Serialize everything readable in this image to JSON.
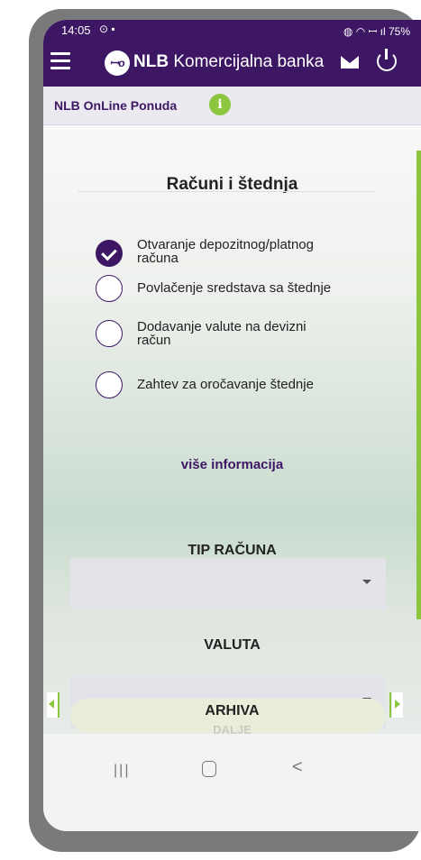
{
  "status_bar": {
    "time": "14:05",
    "left_icons": "⊙ ▪",
    "right_icons": "◍ ◠ ꟷ ıl",
    "battery": "75%"
  },
  "app_bar": {
    "brand_bold": "NLB",
    "brand_rest": " Komercijalna banka",
    "logo_text": "ꟷo"
  },
  "subheader": {
    "label": "NLB OnLine Ponuda",
    "info_glyph": "i"
  },
  "section": {
    "title": "Računi i štednja"
  },
  "options": [
    {
      "line1": "Otvaranje depozitnog/platnog",
      "line2": "računa",
      "checked": true
    },
    {
      "line1": "Povlačenje sredstava sa štednje",
      "line2": "",
      "checked": false
    },
    {
      "line1": "Dodavanje valute na devizni",
      "line2": "račun",
      "checked": false
    },
    {
      "line1": "Zahtev za oročavanje štednje",
      "line2": "",
      "checked": false
    }
  ],
  "more_info": "više informacija",
  "fields": {
    "account_type_label": "TIP RAČUNA",
    "currency_label": "VALUTA"
  },
  "bottom": {
    "archive_label": "ARHIVA",
    "ghost_label": "DALJE"
  },
  "colors": {
    "primary": "#3d1763",
    "accent": "#8cc63f"
  }
}
